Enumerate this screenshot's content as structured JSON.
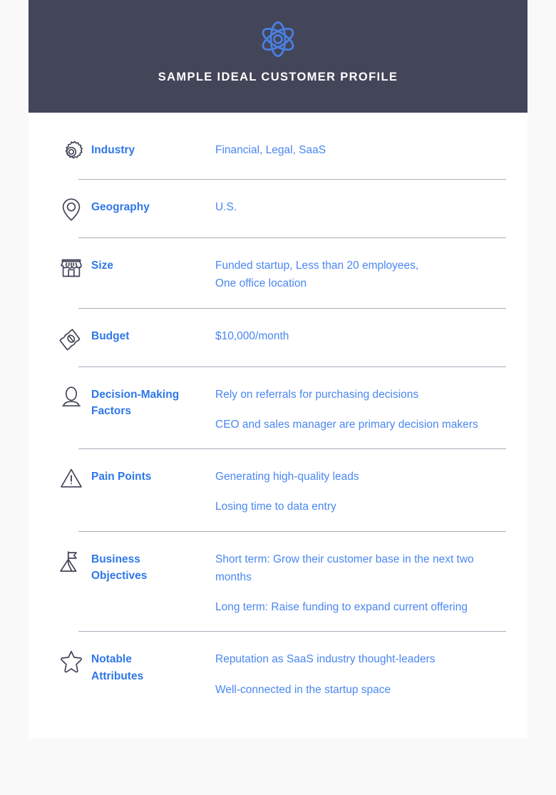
{
  "page": {
    "background_color": "#f9f9f9",
    "card_background_color": "#ffffff"
  },
  "header": {
    "background_color": "#434559",
    "logo_icon": "atom-icon",
    "logo_color": "#4a7fe0",
    "title": "SAMPLE IDEAL CUSTOMER PROFILE",
    "title_color": "#ffffff"
  },
  "theme": {
    "label_color": "#2f77e8",
    "value_color": "#4a87f0",
    "icon_color": "#434559",
    "divider_color": "#aaaeba"
  },
  "rows": [
    {
      "icon": "gear-icon",
      "label": "Industry",
      "values": [
        "Financial, Legal, SaaS"
      ],
      "divider": true
    },
    {
      "icon": "map-pin-icon",
      "label": "Geography",
      "values": [
        "U.S."
      ],
      "divider": true
    },
    {
      "icon": "storefront-icon",
      "label": "Size",
      "values": [
        "Funded startup, Less than 20 employees,\nOne office location"
      ],
      "divider": true
    },
    {
      "icon": "money-bill-icon",
      "label": "Budget",
      "values": [
        "$10,000/month"
      ],
      "divider": true
    },
    {
      "icon": "person-icon",
      "label": "Decision-Making\nFactors",
      "values": [
        "Rely on referrals for purchasing decisions",
        "CEO and sales manager are primary decision makers"
      ],
      "divider": true
    },
    {
      "icon": "warning-triangle-icon",
      "label": "Pain Points",
      "values": [
        "Generating high-quality leads",
        "Losing time to data entry"
      ],
      "divider": true
    },
    {
      "icon": "mountain-flag-icon",
      "label": "Business\nObjectives",
      "values": [
        "Short term: Grow their customer base in the next two months",
        "Long term: Raise funding to expand current offering"
      ],
      "divider": true
    },
    {
      "icon": "star-icon",
      "label": "Notable\nAttributes",
      "values": [
        "Reputation as SaaS industry thought-leaders",
        "Well-connected in the startup space"
      ],
      "divider": false
    }
  ]
}
